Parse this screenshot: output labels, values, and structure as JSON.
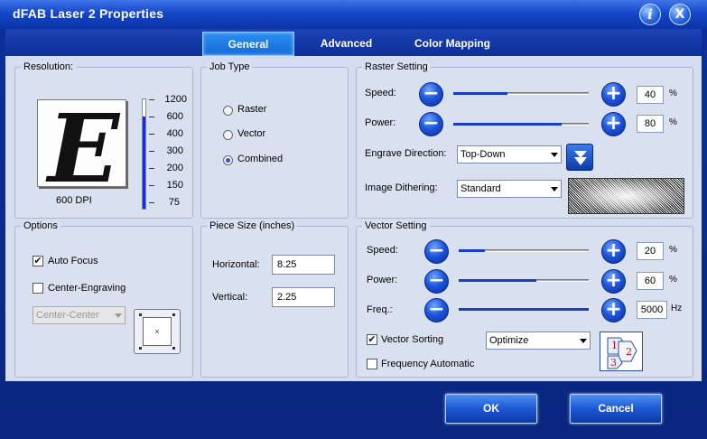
{
  "window": {
    "title": "dFAB Laser 2 Properties",
    "info_icon": "i",
    "close_icon": "X"
  },
  "tabs": [
    {
      "label": "General",
      "active": true
    },
    {
      "label": "Advanced",
      "active": false
    },
    {
      "label": "Color Mapping",
      "active": false
    }
  ],
  "resolution": {
    "label": "Resolution:",
    "preview_letter": "E",
    "current": "600 DPI",
    "values": [
      "1200",
      "600",
      "400",
      "300",
      "200",
      "150",
      "75"
    ],
    "selected": "600"
  },
  "job_type": {
    "label": "Job Type",
    "options": [
      "Raster",
      "Vector",
      "Combined"
    ],
    "selected": "Combined"
  },
  "raster": {
    "label": "Raster Setting",
    "speed_label": "Speed:",
    "speed_value": "40",
    "power_label": "Power:",
    "power_value": "80",
    "percent": "%",
    "engrave_label": "Engrave Direction:",
    "engrave_value": "Top-Down",
    "dither_label": "Image Dithering:",
    "dither_value": "Standard"
  },
  "options": {
    "label": "Options",
    "auto_focus_label": "Auto Focus",
    "auto_focus_checked": true,
    "center_engraving_label": "Center-Engraving",
    "center_engraving_checked": false,
    "center_mode": "Center-Center",
    "center_mark": "×"
  },
  "piece_size": {
    "label": "Piece Size (inches)",
    "horizontal_label": "Horizontal:",
    "horizontal_value": "8.25",
    "vertical_label": "Vertical:",
    "vertical_value": "2.25"
  },
  "vector": {
    "label": "Vector Setting",
    "speed_label": "Speed:",
    "speed_value": "20",
    "power_label": "Power:",
    "power_value": "60",
    "freq_label": "Freq.:",
    "freq_value": "5000",
    "freq_unit": "Hz",
    "percent": "%",
    "sorting_label": "Vector Sorting",
    "sorting_checked": true,
    "sorting_value": "Optimize",
    "freq_auto_label": "Frequency Automatic",
    "freq_auto_checked": false,
    "sort_digits": [
      "1",
      "2",
      "3"
    ]
  },
  "buttons": {
    "ok": "OK",
    "cancel": "Cancel"
  },
  "colors": {
    "accent": "#1a3dc8",
    "panel": "#d9e1f1",
    "frame": "#0a2a7a"
  }
}
